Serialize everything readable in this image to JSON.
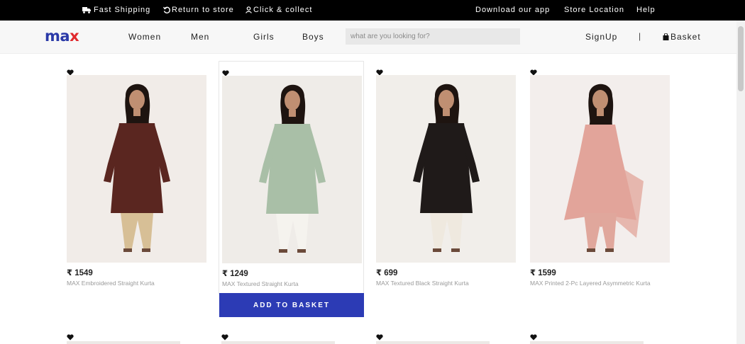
{
  "topbar": {
    "fast_shipping": "Fast Shipping",
    "return_to_store": "Return to store",
    "click_collect": "Click & collect",
    "download_app": "Download our app",
    "store_location": "Store Location",
    "help": "Help"
  },
  "header": {
    "logo_a": "ma",
    "logo_b": "x",
    "nav": [
      "Women",
      "Men",
      "Girls",
      "Boys"
    ],
    "search_placeholder": "what are you looking for?",
    "signup": "SignUp",
    "separator": "|",
    "basket": "Basket"
  },
  "products": [
    {
      "price": "₹ 1549",
      "name": "MAX Embroidered Straight Kurta",
      "kurta_color": "#5a2620",
      "pants_color": "#d7bf96",
      "bg": "#f1ece8"
    },
    {
      "price": "₹ 1249",
      "name": "MAX Textured Straight Kurta",
      "kurta_color": "#a9bfa7",
      "pants_color": "#f5f3ee",
      "bg": "#efece8"
    },
    {
      "price": "₹ 699",
      "name": "MAX Textured Black Straight Kurta",
      "kurta_color": "#1f1a19",
      "pants_color": "#efe9df",
      "bg": "#f1eeea"
    },
    {
      "price": "₹ 1599",
      "name": "MAX Printed 2-Pc Layered Asymmetric Kurta",
      "kurta_color": "#e2a49a",
      "pants_color": "#e0a79c",
      "bg": "#f3eeec"
    }
  ],
  "add_to_basket": "ADD TO BASKET",
  "colors": {
    "accent": "#2c3bb5",
    "logo_blue": "#2b3aa8",
    "logo_red": "#e0282c"
  },
  "icons": [
    "truck-icon",
    "return-icon",
    "person-icon",
    "heart-icon",
    "bag-icon"
  ]
}
